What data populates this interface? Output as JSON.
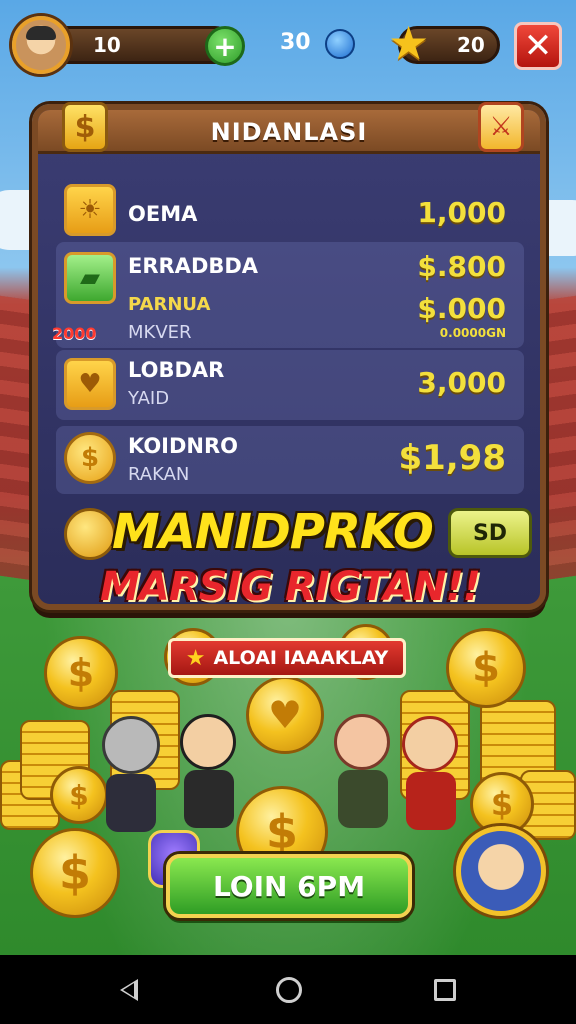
{
  "top_bar": {
    "player_count": "10",
    "gems": "30",
    "stars": "20"
  },
  "panel": {
    "title": "NIDANLASI",
    "rows": [
      {
        "name": "OEMA",
        "value": "1,000",
        "icon": "sun-badge-icon"
      },
      {
        "name": "ERRADBDA",
        "value": "$.800",
        "sub": "PARNUA",
        "sub2": "MKVER",
        "value2": "$.000",
        "small": "0.0000GN",
        "tag": "2000",
        "icon": "cash-card-icon"
      },
      {
        "name": "LOBDAR",
        "sub": "YAID",
        "value": "3,000",
        "icon": "heart-shield-icon"
      },
      {
        "name": "KOIDNRO",
        "sub": "RAKAN",
        "value": "$1,98",
        "icon": "dollar-coin-icon"
      }
    ],
    "banner_main": "MANIDPRKO",
    "banner_chip": "SD",
    "banner_sub": "MARSIG  RIGTAN!!"
  },
  "scene": {
    "label_banner": "ALOAI IAAAKLAY",
    "cta_label": "LOIN 6PM"
  },
  "colors": {
    "accent_gold": "#f3e03c",
    "panel_bg": "#3b3d73",
    "frame_brown": "#7b4a24",
    "cta_green": "#2f9d25",
    "close_red": "#d81c14"
  }
}
